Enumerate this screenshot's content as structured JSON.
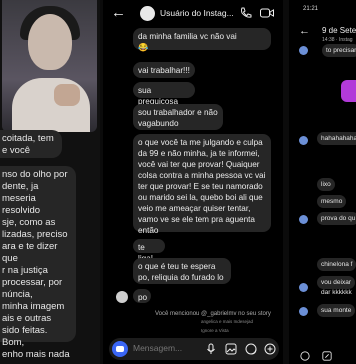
{
  "left": {
    "bubble1": "coitada, tem\ne você",
    "bubble2": "nso do olho por\ndente, ja\nmeseria resolvido\nsje, como as\nlizadas, preciso\nara e te dizer que\nr na justiça\nprocessar, por\nnúncia,\nminha imagem\nais e outras\nsido feitas. Bom,\nenho mais nada a\ni ver chegar uma\ncasa e se é pra\nentão vamos se"
  },
  "mid": {
    "username": "Usuário do Instag...",
    "messages": {
      "m1_text": "da minha familia vc não vai",
      "m1_emoji": "😂",
      "m2": "vai trabalhar!!!",
      "m3": "sua preguiçosa",
      "m4": "sou trabalhador e não vagabundo",
      "m5": "o que você ta me julgando e culpa da 99 e não minha, ja te informei, você vai ter que provar! Quaiquer colsa contra a minha pessoa vc vai ter que provar! E se teu namorado ou marido sei la, quebo boi ali que veio me ameaçar quiser tentar, vamo ve se ele tem pra aguenta então",
      "m6": "te liga!",
      "m7": "o que é teu te espera po, reliquia do furado lo",
      "m8": "po"
    },
    "story_note": "Você mencionou @_gabrielmv no seu story",
    "story_note2": "angelica e mais Indesejad",
    "story_note3": "Ignore a Vista",
    "input_placeholder": "Mensagem..."
  },
  "right": {
    "status_time": "21:21",
    "title": "9 de Setem",
    "subtitle": "14:38 · Instag",
    "top_bubble": "to precisar",
    "b1": "hahahahahah",
    "b2": "lixo",
    "b3": "mesmo",
    "b4": "prova do qu",
    "b5": "chinelona f",
    "b6": "vou deixar",
    "b6b": "dar kkkkkk",
    "b7": "sua monte"
  },
  "colors": {
    "bubble": "#262626",
    "camera_button": "#3a66f5",
    "accent_purple": "#b23ad9"
  }
}
